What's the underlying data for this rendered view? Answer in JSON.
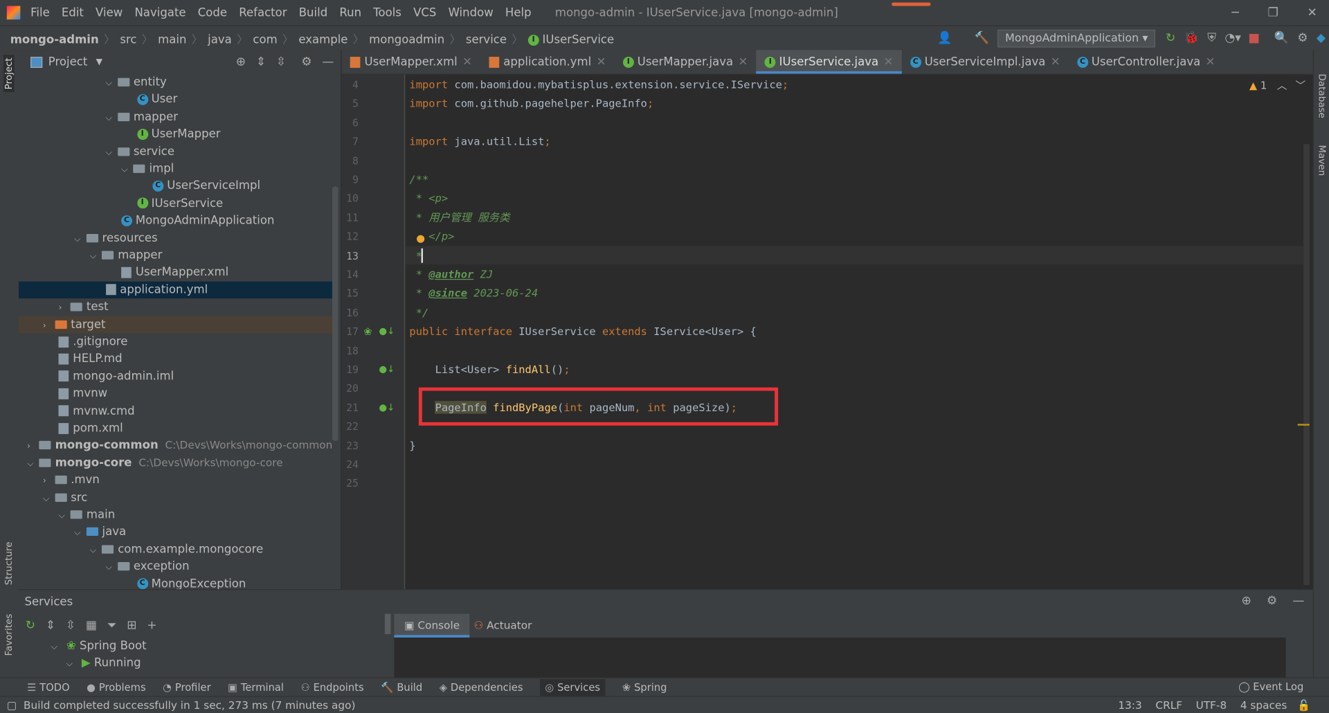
{
  "window": {
    "title": "mongo-admin - IUserService.java [mongo-admin]"
  },
  "menu": [
    "File",
    "Edit",
    "View",
    "Navigate",
    "Code",
    "Refactor",
    "Build",
    "Run",
    "Tools",
    "VCS",
    "Window",
    "Help"
  ],
  "breadcrumb": [
    "mongo-admin",
    "src",
    "main",
    "java",
    "com",
    "example",
    "mongoadmin",
    "service",
    "IUserService"
  ],
  "run_config": "MongoAdminApplication",
  "project_panel": {
    "title": "Project"
  },
  "tree": [
    {
      "label": "entity",
      "indent": 5,
      "type": "folder",
      "open": true
    },
    {
      "label": "User",
      "indent": 7,
      "type": "class"
    },
    {
      "label": "mapper",
      "indent": 5,
      "type": "folder",
      "open": true
    },
    {
      "label": "UserMapper",
      "indent": 7,
      "type": "interface"
    },
    {
      "label": "service",
      "indent": 5,
      "type": "folder",
      "open": true
    },
    {
      "label": "impl",
      "indent": 6,
      "type": "folder",
      "open": true
    },
    {
      "label": "UserServiceImpl",
      "indent": 8,
      "type": "class"
    },
    {
      "label": "IUserService",
      "indent": 7,
      "type": "interface"
    },
    {
      "label": "MongoAdminApplication",
      "indent": 6,
      "type": "class"
    },
    {
      "label": "resources",
      "indent": 3,
      "type": "folder",
      "open": true
    },
    {
      "label": "mapper",
      "indent": 4,
      "type": "folder",
      "open": true
    },
    {
      "label": "UserMapper.xml",
      "indent": 6,
      "type": "file"
    },
    {
      "label": "application.yml",
      "indent": 5,
      "type": "file",
      "selected": true
    },
    {
      "label": "test",
      "indent": 2,
      "type": "folder",
      "open": false
    },
    {
      "label": "target",
      "indent": 1,
      "type": "folder-orange",
      "open": false
    },
    {
      "label": ".gitignore",
      "indent": 2,
      "type": "file"
    },
    {
      "label": "HELP.md",
      "indent": 2,
      "type": "file"
    },
    {
      "label": "mongo-admin.iml",
      "indent": 2,
      "type": "file"
    },
    {
      "label": "mvnw",
      "indent": 2,
      "type": "file"
    },
    {
      "label": "mvnw.cmd",
      "indent": 2,
      "type": "file"
    },
    {
      "label": "pom.xml",
      "indent": 2,
      "type": "file"
    },
    {
      "label": "mongo-common",
      "indent": 0,
      "type": "module",
      "open": false,
      "path": "C:\\Devs\\Works\\mongo-common"
    },
    {
      "label": "mongo-core",
      "indent": 0,
      "type": "module",
      "open": true,
      "path": "C:\\Devs\\Works\\mongo-core"
    },
    {
      "label": ".mvn",
      "indent": 1,
      "type": "folder",
      "open": false
    },
    {
      "label": "src",
      "indent": 1,
      "type": "folder",
      "open": true
    },
    {
      "label": "main",
      "indent": 2,
      "type": "folder",
      "open": true
    },
    {
      "label": "java",
      "indent": 3,
      "type": "folder-blue",
      "open": true
    },
    {
      "label": "com.example.mongocore",
      "indent": 4,
      "type": "folder",
      "open": true
    },
    {
      "label": "exception",
      "indent": 5,
      "type": "folder",
      "open": true
    },
    {
      "label": "MongoException",
      "indent": 7,
      "type": "class"
    }
  ],
  "tabs": [
    {
      "label": "UserMapper.xml",
      "active": false
    },
    {
      "label": "application.yml",
      "active": false
    },
    {
      "label": "UserMapper.java",
      "active": false
    },
    {
      "label": "IUserService.java",
      "active": true
    },
    {
      "label": "UserServiceImpl.java",
      "active": false
    },
    {
      "label": "UserController.java",
      "active": false
    }
  ],
  "editor": {
    "warnings": "1",
    "current_line": 13,
    "lines": [
      {
        "n": 4,
        "html": "<span class='kw'>import</span> com.baomidou.mybatisplus.extension.service.IService<span class='kw'>;</span>"
      },
      {
        "n": 5,
        "html": "<span class='kw'>import</span> com.github.pagehelper.PageInfo<span class='kw'>;</span>"
      },
      {
        "n": 6,
        "html": ""
      },
      {
        "n": 7,
        "html": "<span class='kw'>import</span> java.util.List<span class='kw'>;</span>"
      },
      {
        "n": 8,
        "html": ""
      },
      {
        "n": 9,
        "html": "<span class='cm'>/**</span>"
      },
      {
        "n": 10,
        "html": "<span class='cm'> * &lt;p&gt;</span>"
      },
      {
        "n": 11,
        "html": "<span class='cm'> * 用户管理 服务类</span>"
      },
      {
        "n": 12,
        "html": "<span class='cm'>   &lt;/p&gt;</span>"
      },
      {
        "n": 13,
        "html": "<span class='cm'> *</span>"
      },
      {
        "n": 14,
        "html": "<span class='cm'> * <span class='tag'>@author</span> ZJ</span>"
      },
      {
        "n": 15,
        "html": "<span class='cm'> * <span class='tag'>@since</span> 2023-06-24</span>"
      },
      {
        "n": 16,
        "html": "<span class='cm'> */</span>"
      },
      {
        "n": 17,
        "html": "<span class='kw'>public interface</span> IUserService <span class='kw'>extends</span> IService&lt;User&gt; {"
      },
      {
        "n": 18,
        "html": ""
      },
      {
        "n": 19,
        "html": "    List&lt;User&gt; <span class='fn'>findAll</span>()<span class='kw'>;</span>"
      },
      {
        "n": 20,
        "html": ""
      },
      {
        "n": 21,
        "html": "    <span class='hl'>PageInfo</span> <span class='fn'>findByPage</span>(<span class='kw'>int</span> pageNum<span class='kw'>,</span> <span class='kw'>int</span> pageSize)<span class='kw'>;</span>"
      },
      {
        "n": 22,
        "html": ""
      },
      {
        "n": 23,
        "html": "}"
      },
      {
        "n": 24,
        "html": ""
      },
      {
        "n": 25,
        "html": ""
      }
    ]
  },
  "services": {
    "title": "Services",
    "tree": [
      "Spring Boot",
      "Running"
    ],
    "tabs": [
      "Console",
      "Actuator"
    ]
  },
  "bottom_tools": [
    "TODO",
    "Problems",
    "Profiler",
    "Terminal",
    "Endpoints",
    "Build",
    "Dependencies",
    "Services",
    "Spring"
  ],
  "event_log": "Event Log",
  "left_tools": [
    "Project",
    "Structure",
    "Favorites"
  ],
  "right_tools": [
    "Database",
    "Maven"
  ],
  "status": {
    "message": "Build completed successfully in 1 sec, 273 ms (7 minutes ago)",
    "position": "13:3",
    "line_sep": "CRLF",
    "encoding": "UTF-8",
    "indent": "4 spaces"
  },
  "colors": {
    "highlight_box": "#ea3338",
    "accent": "#4a88c7",
    "background": "#2b2b2b"
  }
}
